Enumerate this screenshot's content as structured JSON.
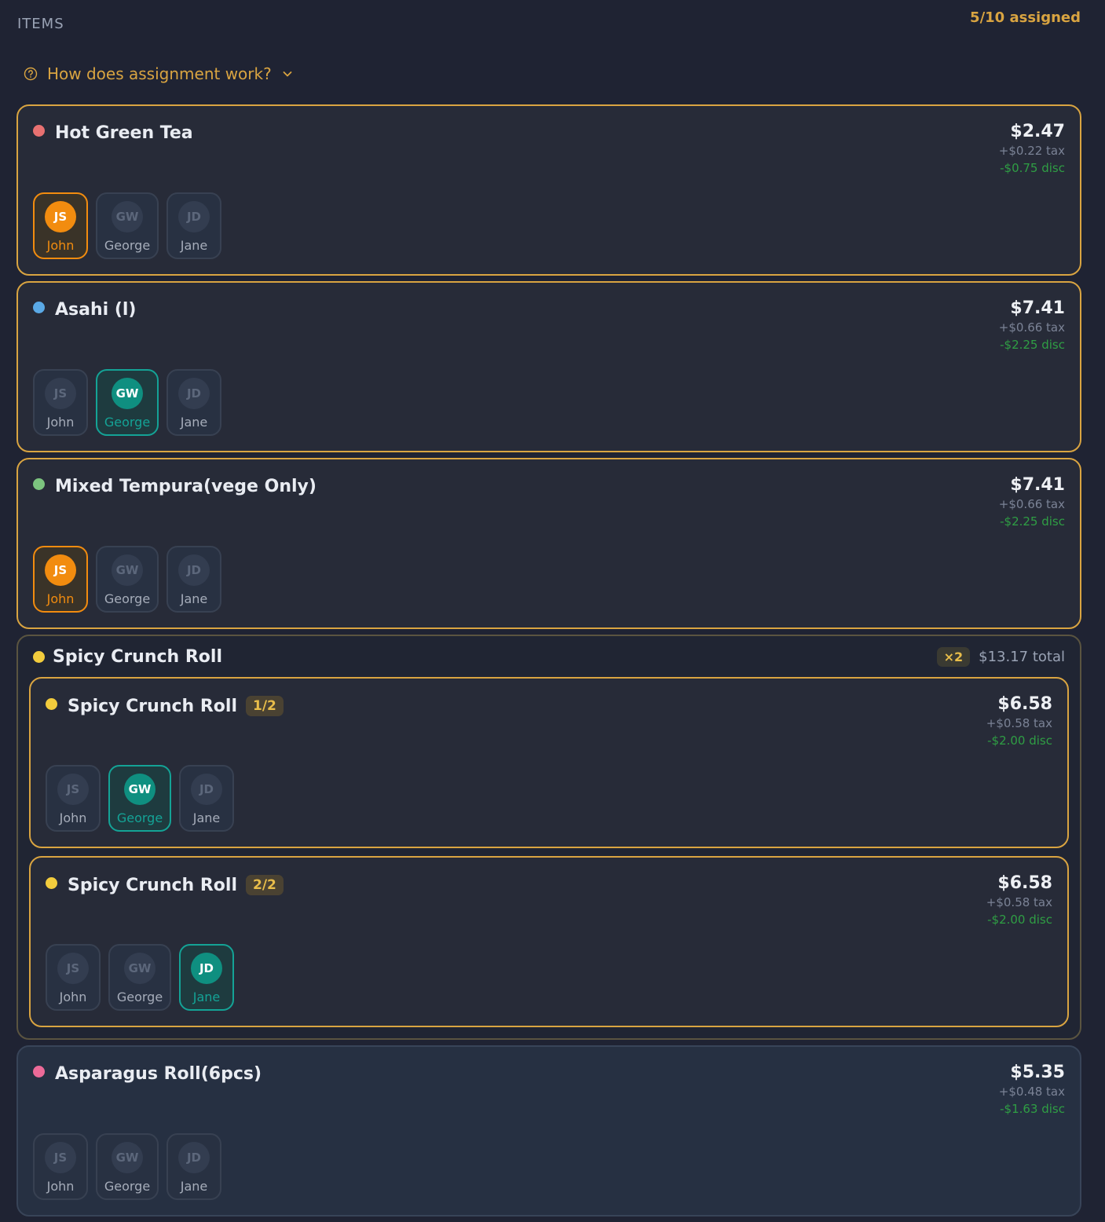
{
  "header": {
    "section_label": "ITEMS",
    "assigned_count": "5/10 assigned",
    "help_label": "How does assignment work?"
  },
  "colors": {
    "accent": "#d9a441",
    "selected_orange": "#f28c0f",
    "selected_teal": "#0f8f80",
    "discount_green": "#2f9e44"
  },
  "icons": {
    "help": "question-circle-icon",
    "chevron": "chevron-down-icon"
  },
  "items": [
    {
      "kind": "single",
      "name": "Hot Green Tea",
      "dot": "#e87171",
      "price": "$2.47",
      "tax": "+$0.22 tax",
      "disc": "-$0.75 disc",
      "people": [
        {
          "initials": "JS",
          "name": "John",
          "state": "orange"
        },
        {
          "initials": "GW",
          "name": "George",
          "state": "none"
        },
        {
          "initials": "JD",
          "name": "Jane",
          "state": "none"
        }
      ]
    },
    {
      "kind": "single",
      "name": "Asahi (l)",
      "dot": "#5aa9e6",
      "price": "$7.41",
      "tax": "+$0.66 tax",
      "disc": "-$2.25 disc",
      "people": [
        {
          "initials": "JS",
          "name": "John",
          "state": "none"
        },
        {
          "initials": "GW",
          "name": "George",
          "state": "teal"
        },
        {
          "initials": "JD",
          "name": "Jane",
          "state": "none"
        }
      ]
    },
    {
      "kind": "single",
      "name": "Mixed Tempura(vege Only)",
      "dot": "#7cc47f",
      "price": "$7.41",
      "tax": "+$0.66 tax",
      "disc": "-$2.25 disc",
      "people": [
        {
          "initials": "JS",
          "name": "John",
          "state": "orange"
        },
        {
          "initials": "GW",
          "name": "George",
          "state": "none"
        },
        {
          "initials": "JD",
          "name": "Jane",
          "state": "none"
        }
      ]
    },
    {
      "kind": "group",
      "name": "Spicy Crunch Roll",
      "dot": "#f2cc3d",
      "qty": "×2",
      "total": "$13.17 total",
      "children": [
        {
          "name": "Spicy Crunch Roll",
          "dot": "#f2cc3d",
          "badge": "1/2",
          "price": "$6.58",
          "tax": "+$0.58 tax",
          "disc": "-$2.00 disc",
          "people": [
            {
              "initials": "JS",
              "name": "John",
              "state": "none"
            },
            {
              "initials": "GW",
              "name": "George",
              "state": "teal"
            },
            {
              "initials": "JD",
              "name": "Jane",
              "state": "none"
            }
          ]
        },
        {
          "name": "Spicy Crunch Roll",
          "dot": "#f2cc3d",
          "badge": "2/2",
          "price": "$6.58",
          "tax": "+$0.58 tax",
          "disc": "-$2.00 disc",
          "people": [
            {
              "initials": "JS",
              "name": "John",
              "state": "none"
            },
            {
              "initials": "GW",
              "name": "George",
              "state": "none"
            },
            {
              "initials": "JD",
              "name": "Jane",
              "state": "teal"
            }
          ]
        }
      ]
    },
    {
      "kind": "single",
      "plain": true,
      "name": "Asparagus Roll(6pcs)",
      "dot": "#ec6a98",
      "price": "$5.35",
      "tax": "+$0.48 tax",
      "disc": "-$1.63 disc",
      "people": [
        {
          "initials": "JS",
          "name": "John",
          "state": "none"
        },
        {
          "initials": "GW",
          "name": "George",
          "state": "none"
        },
        {
          "initials": "JD",
          "name": "Jane",
          "state": "none"
        }
      ]
    }
  ]
}
